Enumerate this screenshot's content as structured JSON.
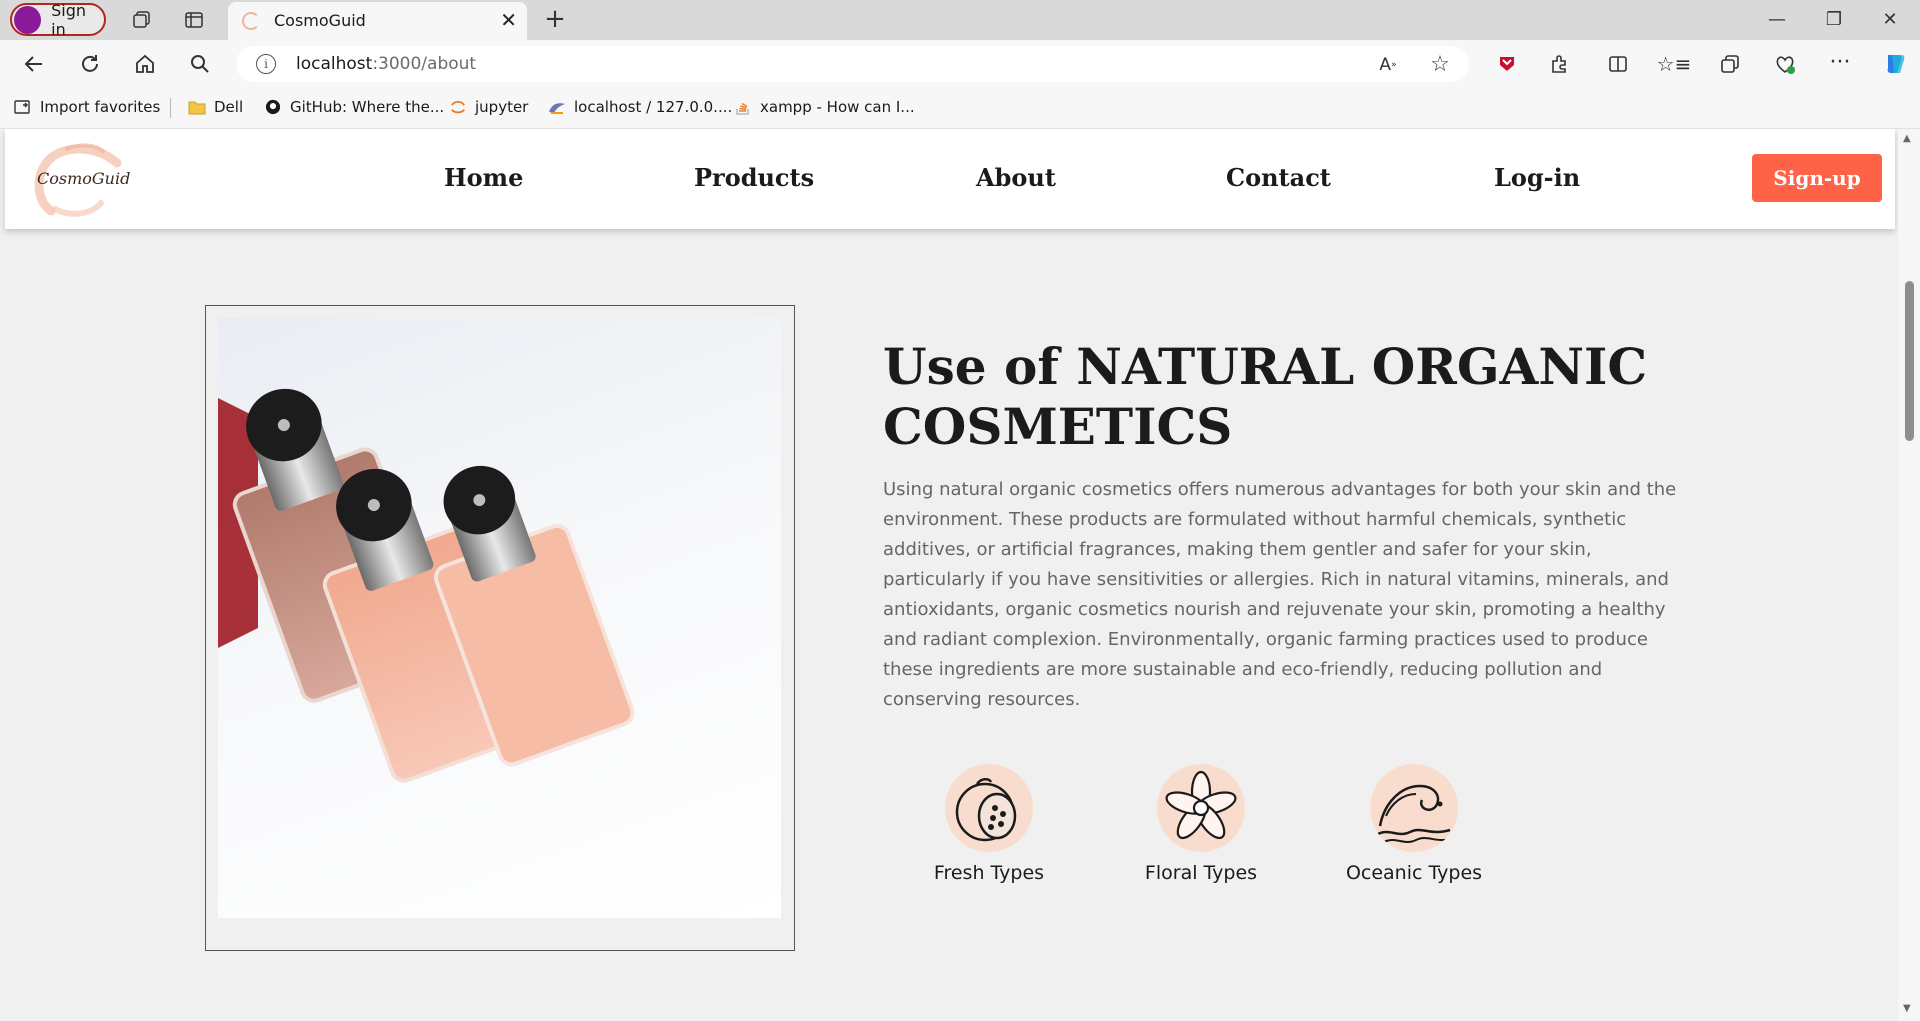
{
  "browser": {
    "signin_label": "Sign in",
    "tab_title": "CosmoGuid",
    "url_host": "localhost",
    "url_path": ":3000/about",
    "bookmarks": [
      {
        "label": "Import favorites"
      },
      {
        "label": "Dell"
      },
      {
        "label": "GitHub: Where the..."
      },
      {
        "label": "jupyter"
      },
      {
        "label": "localhost / 127.0.0...."
      },
      {
        "label": "xampp - How can I..."
      }
    ]
  },
  "site": {
    "logo_text": "CosmoGuid",
    "nav": [
      "Home",
      "Products",
      "About",
      "Contact",
      "Log-in"
    ],
    "signup_label": "Sign-up",
    "colors": {
      "accent": "#ff6347",
      "icon_bg": "#f8dccd"
    }
  },
  "about": {
    "headline": "Use of NATURAL ORGANIC COSMETICS",
    "body": "Using natural organic cosmetics offers numerous advantages for both your skin and the environment. These products are formulated without harmful chemicals, synthetic additives, or artificial fragrances, making them gentler and safer for your skin, particularly if you have sensitivities or allergies. Rich in natural vitamins, minerals, and antioxidants, organic cosmetics nourish and rejuvenate your skin, promoting a healthy and radiant complexion. Environmentally, organic farming practices used to produce these ingredients are more sustainable and eco-friendly, reducing pollution and conserving resources.",
    "features": [
      {
        "label": "Fresh Types",
        "icon": "fruit-icon"
      },
      {
        "label": "Floral Types",
        "icon": "flower-icon"
      },
      {
        "label": "Oceanic Types",
        "icon": "wave-icon"
      }
    ]
  }
}
